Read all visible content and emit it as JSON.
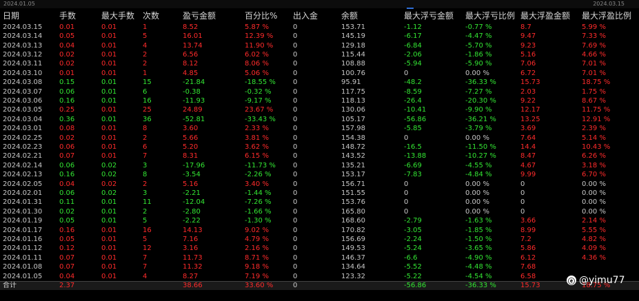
{
  "topbar": {
    "start_date": "2024.01.05",
    "end_date": "2024.03.15"
  },
  "colors": {
    "positive": "#ff2b2b",
    "negative": "#33e633",
    "background": "#000000"
  },
  "headers": [
    "日期",
    "手数",
    "最大手数",
    "次数",
    "盈亏金额",
    "百分比%",
    "出入金",
    "余额",
    "最大浮亏金额",
    "最大浮亏比例",
    "最大浮盈金额",
    "最大浮盈比例"
  ],
  "rows": [
    {
      "date": "2024.03.15",
      "lots": "0.01",
      "max_lots": "0.01",
      "count": "1",
      "pnl": "8.52",
      "pct": "5.87 %",
      "io": "0",
      "balance": "153.71",
      "max_dd": "-1.12",
      "max_dd_pct": "-0.77 %",
      "max_up": "8.7",
      "max_up_pct": "5.99 %",
      "dir": "red"
    },
    {
      "date": "2024.03.14",
      "lots": "0.05",
      "max_lots": "0.01",
      "count": "5",
      "pnl": "16.01",
      "pct": "12.39 %",
      "io": "0",
      "balance": "145.19",
      "max_dd": "-6.17",
      "max_dd_pct": "-4.47 %",
      "max_up": "9.47",
      "max_up_pct": "7.33 %",
      "dir": "red"
    },
    {
      "date": "2024.03.13",
      "lots": "0.04",
      "max_lots": "0.01",
      "count": "4",
      "pnl": "13.74",
      "pct": "11.90 %",
      "io": "0",
      "balance": "129.18",
      "max_dd": "-6.84",
      "max_dd_pct": "-5.70 %",
      "max_up": "9.23",
      "max_up_pct": "7.69 %",
      "dir": "red"
    },
    {
      "date": "2024.03.12",
      "lots": "0.02",
      "max_lots": "0.01",
      "count": "2",
      "pnl": "6.56",
      "pct": "6.02 %",
      "io": "0",
      "balance": "115.44",
      "max_dd": "-2.06",
      "max_dd_pct": "-1.86 %",
      "max_up": "5.16",
      "max_up_pct": "4.66 %",
      "dir": "red"
    },
    {
      "date": "2024.03.11",
      "lots": "0.02",
      "max_lots": "0.01",
      "count": "2",
      "pnl": "8.12",
      "pct": "8.06 %",
      "io": "0",
      "balance": "108.88",
      "max_dd": "-5.94",
      "max_dd_pct": "-5.90 %",
      "max_up": "7.06",
      "max_up_pct": "7.01 %",
      "dir": "red"
    },
    {
      "date": "2024.03.10",
      "lots": "0.01",
      "max_lots": "0.01",
      "count": "1",
      "pnl": "4.85",
      "pct": "5.06 %",
      "io": "0",
      "balance": "100.76",
      "max_dd": "0",
      "max_dd_pct": "0.00 %",
      "max_up": "6.72",
      "max_up_pct": "7.01 %",
      "dir": "red"
    },
    {
      "date": "2024.03.08",
      "lots": "0.15",
      "max_lots": "0.01",
      "count": "15",
      "pnl": "-21.84",
      "pct": "-18.55 %",
      "io": "0",
      "balance": "95.91",
      "max_dd": "-48.2",
      "max_dd_pct": "-36.33 %",
      "max_up": "15.73",
      "max_up_pct": "18.75 %",
      "dir": "green"
    },
    {
      "date": "2024.03.07",
      "lots": "0.06",
      "max_lots": "0.01",
      "count": "6",
      "pnl": "-0.38",
      "pct": "-0.32 %",
      "io": "0",
      "balance": "117.75",
      "max_dd": "-8.59",
      "max_dd_pct": "-7.27 %",
      "max_up": "2.03",
      "max_up_pct": "1.75 %",
      "dir": "green"
    },
    {
      "date": "2024.03.06",
      "lots": "0.16",
      "max_lots": "0.01",
      "count": "16",
      "pnl": "-11.93",
      "pct": "-9.17 %",
      "io": "0",
      "balance": "118.13",
      "max_dd": "-26.4",
      "max_dd_pct": "-20.30 %",
      "max_up": "9.22",
      "max_up_pct": "8.67 %",
      "dir": "green"
    },
    {
      "date": "2024.03.05",
      "lots": "0.25",
      "max_lots": "0.01",
      "count": "25",
      "pnl": "24.89",
      "pct": "23.67 %",
      "io": "0",
      "balance": "130.06",
      "max_dd": "-10.41",
      "max_dd_pct": "-9.90 %",
      "max_up": "12.17",
      "max_up_pct": "11.75 %",
      "dir": "red"
    },
    {
      "date": "2024.03.04",
      "lots": "0.36",
      "max_lots": "0.01",
      "count": "36",
      "pnl": "-52.81",
      "pct": "-33.43 %",
      "io": "0",
      "balance": "105.17",
      "max_dd": "-56.86",
      "max_dd_pct": "-36.21 %",
      "max_up": "13.25",
      "max_up_pct": "12.91 %",
      "dir": "green"
    },
    {
      "date": "2024.03.01",
      "lots": "0.08",
      "max_lots": "0.01",
      "count": "8",
      "pnl": "3.60",
      "pct": "2.33 %",
      "io": "0",
      "balance": "157.98",
      "max_dd": "-5.85",
      "max_dd_pct": "-3.79 %",
      "max_up": "3.69",
      "max_up_pct": "2.39 %",
      "dir": "red"
    },
    {
      "date": "2024.02.25",
      "lots": "0.02",
      "max_lots": "0.01",
      "count": "2",
      "pnl": "5.66",
      "pct": "3.81 %",
      "io": "0",
      "balance": "154.38",
      "max_dd": "0",
      "max_dd_pct": "0.00 %",
      "max_up": "7.64",
      "max_up_pct": "5.14 %",
      "dir": "red"
    },
    {
      "date": "2024.02.23",
      "lots": "0.06",
      "max_lots": "0.01",
      "count": "6",
      "pnl": "5.20",
      "pct": "3.62 %",
      "io": "0",
      "balance": "148.72",
      "max_dd": "-16.5",
      "max_dd_pct": "-11.50 %",
      "max_up": "14.4",
      "max_up_pct": "10.43 %",
      "dir": "red"
    },
    {
      "date": "2024.02.21",
      "lots": "0.07",
      "max_lots": "0.01",
      "count": "7",
      "pnl": "8.31",
      "pct": "6.15 %",
      "io": "0",
      "balance": "143.52",
      "max_dd": "-13.88",
      "max_dd_pct": "-10.27 %",
      "max_up": "8.47",
      "max_up_pct": "6.26 %",
      "dir": "red"
    },
    {
      "date": "2024.02.14",
      "lots": "0.06",
      "max_lots": "0.02",
      "count": "3",
      "pnl": "-17.96",
      "pct": "-11.73 %",
      "io": "0",
      "balance": "135.21",
      "max_dd": "-6.69",
      "max_dd_pct": "-4.55 %",
      "max_up": "4.67",
      "max_up_pct": "3.18 %",
      "dir": "green"
    },
    {
      "date": "2024.02.13",
      "lots": "0.16",
      "max_lots": "0.02",
      "count": "8",
      "pnl": "-3.54",
      "pct": "-2.26 %",
      "io": "0",
      "balance": "153.17",
      "max_dd": "-7.83",
      "max_dd_pct": "-4.84 %",
      "max_up": "9.99",
      "max_up_pct": "6.70 %",
      "dir": "green"
    },
    {
      "date": "2024.02.05",
      "lots": "0.04",
      "max_lots": "0.02",
      "count": "2",
      "pnl": "5.16",
      "pct": "3.40 %",
      "io": "0",
      "balance": "156.71",
      "max_dd": "0",
      "max_dd_pct": "0.00 %",
      "max_up": "0",
      "max_up_pct": "0.00 %",
      "dir": "red"
    },
    {
      "date": "2024.02.01",
      "lots": "0.06",
      "max_lots": "0.02",
      "count": "3",
      "pnl": "-2.21",
      "pct": "-1.44 %",
      "io": "0",
      "balance": "151.55",
      "max_dd": "0",
      "max_dd_pct": "0.00 %",
      "max_up": "0",
      "max_up_pct": "0.00 %",
      "dir": "green"
    },
    {
      "date": "2024.01.31",
      "lots": "0.11",
      "max_lots": "0.01",
      "count": "11",
      "pnl": "-12.04",
      "pct": "-7.26 %",
      "io": "0",
      "balance": "153.76",
      "max_dd": "0",
      "max_dd_pct": "0.00 %",
      "max_up": "0",
      "max_up_pct": "0.00 %",
      "dir": "green"
    },
    {
      "date": "2024.01.30",
      "lots": "0.02",
      "max_lots": "0.01",
      "count": "2",
      "pnl": "-2.80",
      "pct": "-1.66 %",
      "io": "0",
      "balance": "165.80",
      "max_dd": "0",
      "max_dd_pct": "0.00 %",
      "max_up": "0",
      "max_up_pct": "0.00 %",
      "dir": "green"
    },
    {
      "date": "2024.01.19",
      "lots": "0.05",
      "max_lots": "0.01",
      "count": "5",
      "pnl": "-2.22",
      "pct": "-1.30 %",
      "io": "0",
      "balance": "168.60",
      "max_dd": "-2.79",
      "max_dd_pct": "-1.63 %",
      "max_up": "3.66",
      "max_up_pct": "2.14 %",
      "dir": "green"
    },
    {
      "date": "2024.01.17",
      "lots": "0.16",
      "max_lots": "0.01",
      "count": "16",
      "pnl": "14.13",
      "pct": "9.02 %",
      "io": "0",
      "balance": "170.82",
      "max_dd": "-3.05",
      "max_dd_pct": "-1.85 %",
      "max_up": "8.99",
      "max_up_pct": "5.55 %",
      "dir": "red"
    },
    {
      "date": "2024.01.16",
      "lots": "0.05",
      "max_lots": "0.01",
      "count": "5",
      "pnl": "7.16",
      "pct": "4.79 %",
      "io": "0",
      "balance": "156.69",
      "max_dd": "-2.24",
      "max_dd_pct": "-1.50 %",
      "max_up": "7.2",
      "max_up_pct": "4.82 %",
      "dir": "red"
    },
    {
      "date": "2024.01.12",
      "lots": "0.12",
      "max_lots": "0.01",
      "count": "12",
      "pnl": "3.16",
      "pct": "2.16 %",
      "io": "0",
      "balance": "149.53",
      "max_dd": "-5.24",
      "max_dd_pct": "-3.65 %",
      "max_up": "5.86",
      "max_up_pct": "4.09 %",
      "dir": "red"
    },
    {
      "date": "2024.01.11",
      "lots": "0.07",
      "max_lots": "0.01",
      "count": "7",
      "pnl": "11.73",
      "pct": "8.71 %",
      "io": "0",
      "balance": "146.37",
      "max_dd": "-6.6",
      "max_dd_pct": "-4.90 %",
      "max_up": "6.12",
      "max_up_pct": "4.36 %",
      "dir": "red"
    },
    {
      "date": "2024.01.08",
      "lots": "0.07",
      "max_lots": "0.01",
      "count": "7",
      "pnl": "11.32",
      "pct": "9.18 %",
      "io": "0",
      "balance": "134.64",
      "max_dd": "-5.52",
      "max_dd_pct": "-4.48 %",
      "max_up": "7.68",
      "max_up_pct": "",
      "dir": "red"
    },
    {
      "date": "2024.01.05",
      "lots": "0.04",
      "max_lots": "0.01",
      "count": "4",
      "pnl": "8.27",
      "pct": "7.19 %",
      "io": "0",
      "balance": "123.32",
      "max_dd": "-5.22",
      "max_dd_pct": "-4.54 %",
      "max_up": "6.58",
      "max_up_pct": "",
      "dir": "red"
    }
  ],
  "summary": {
    "label": "合计",
    "lots": "2.37",
    "max_lots": "",
    "count": "",
    "pnl": "38.66",
    "pct": "33.60 %",
    "io": "0",
    "balance": "",
    "max_dd": "-56.86",
    "max_dd_pct": "-36.33 %",
    "max_up": "15.73",
    "max_up_pct": "18.75 %"
  },
  "watermark": {
    "icon": "weibo-icon",
    "text": "@yimu77"
  }
}
